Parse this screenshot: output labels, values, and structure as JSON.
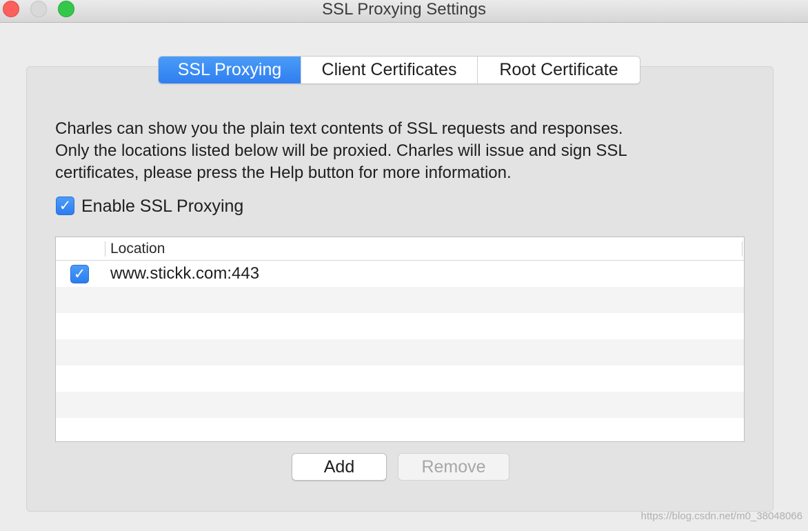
{
  "window": {
    "title": "SSL Proxying Settings"
  },
  "tabs": [
    {
      "label": "SSL Proxying",
      "active": true
    },
    {
      "label": "Client Certificates",
      "active": false
    },
    {
      "label": "Root Certificate",
      "active": false
    }
  ],
  "description": {
    "lines": [
      "Charles can show you the plain text contents of SSL requests and responses.",
      "Only the locations listed below will be proxied. Charles will issue and sign SSL",
      "certificates, please press the Help button for more information."
    ]
  },
  "enable_ssl": {
    "label": "Enable SSL Proxying",
    "checked": true
  },
  "locations_table": {
    "columns": [
      "",
      "Location"
    ],
    "rows": [
      {
        "enabled": true,
        "location": "www.stickk.com:443"
      }
    ]
  },
  "buttons": {
    "add_label": "Add",
    "remove_label": "Remove",
    "remove_enabled": false
  },
  "watermark": "https://blog.csdn.net/m0_38048066",
  "icons": {
    "checkmark": "checkmark-icon"
  },
  "colors": {
    "accent": "#2f7ef1",
    "close": "#fc605c",
    "zoom": "#34c84a"
  }
}
